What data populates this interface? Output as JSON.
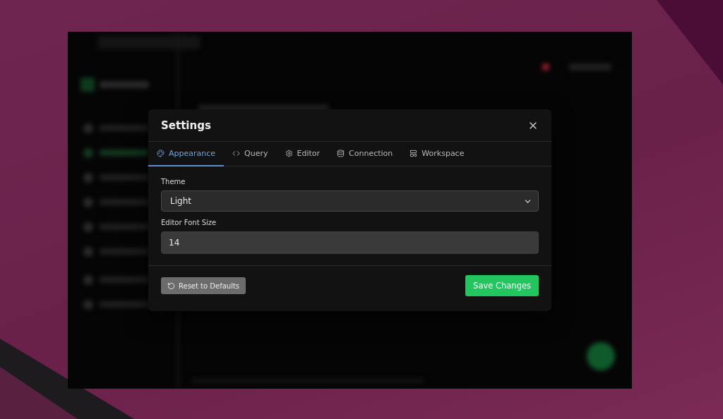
{
  "dialog": {
    "title": "Settings",
    "tabs": [
      {
        "label": "Appearance",
        "selected": true
      },
      {
        "label": "Query",
        "selected": false
      },
      {
        "label": "Editor",
        "selected": false
      },
      {
        "label": "Connection",
        "selected": false
      },
      {
        "label": "Workspace",
        "selected": false
      }
    ],
    "fields": [
      {
        "kind": "select",
        "label": "Theme",
        "value": "Light"
      },
      {
        "kind": "input",
        "label": "Editor Font Size",
        "value": "14"
      }
    ],
    "reset_button": "Reset to Defaults",
    "save_button": "Save Changes"
  }
}
